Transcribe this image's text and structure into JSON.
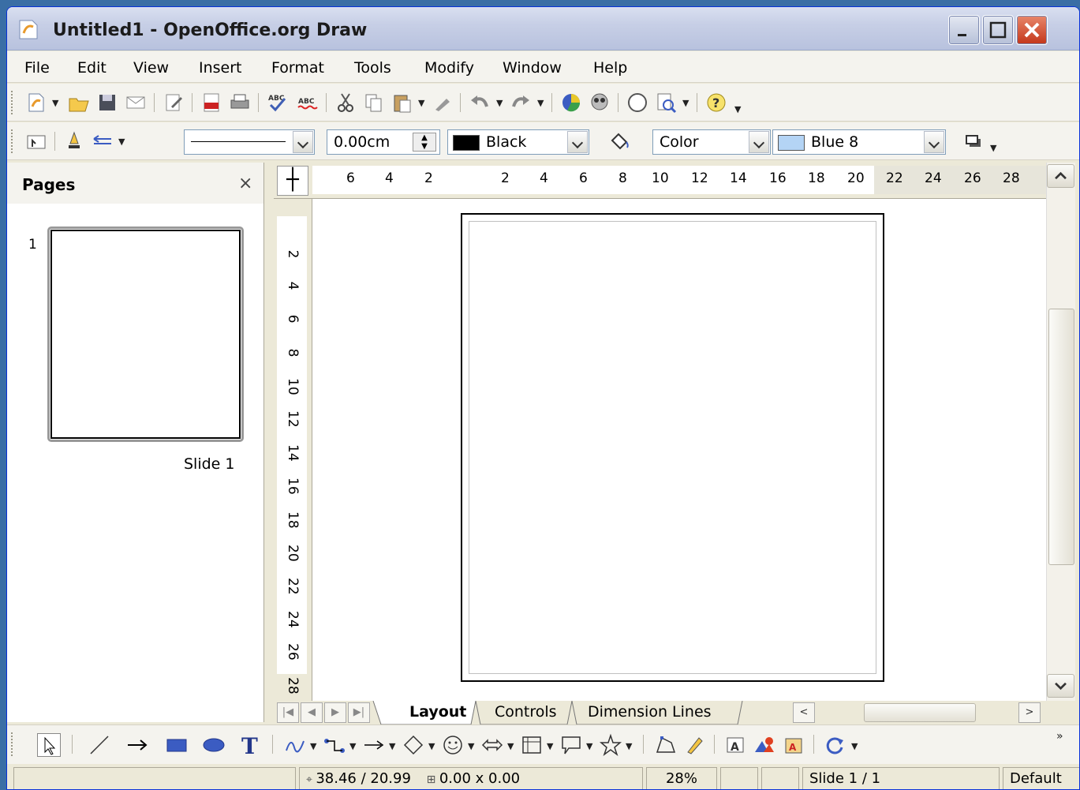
{
  "window": {
    "title": "Untitled1 - OpenOffice.org Draw",
    "icon": "openoffice-draw-icon"
  },
  "menu": [
    "File",
    "Edit",
    "View",
    "Insert",
    "Format",
    "Tools",
    "Modify",
    "Window",
    "Help"
  ],
  "line_style": {
    "line_width": "0.00cm",
    "line_color": "Black",
    "line_color_hex": "#000000",
    "area_style": "Color",
    "area_color": "Blue 8",
    "area_color_hex": "#b4d4f5"
  },
  "pages_panel": {
    "title": "Pages",
    "slide_number": "1",
    "slide_label": "Slide 1"
  },
  "ruler": {
    "top_ticks": [
      "6",
      "4",
      "2",
      "2",
      "4",
      "6",
      "8",
      "10",
      "12",
      "14",
      "16",
      "18",
      "20",
      "22",
      "24",
      "26",
      "28"
    ],
    "left_ticks": [
      "2",
      "4",
      "6",
      "8",
      "10",
      "12",
      "14",
      "16",
      "18",
      "20",
      "22",
      "24",
      "26",
      "28"
    ]
  },
  "tabs": [
    "Layout",
    "Controls",
    "Dimension Lines"
  ],
  "status": {
    "position": "38.46 / 20.99",
    "size": "0.00 x 0.00",
    "zoom": "28%",
    "page": "Slide 1 / 1",
    "layout": "Default"
  }
}
